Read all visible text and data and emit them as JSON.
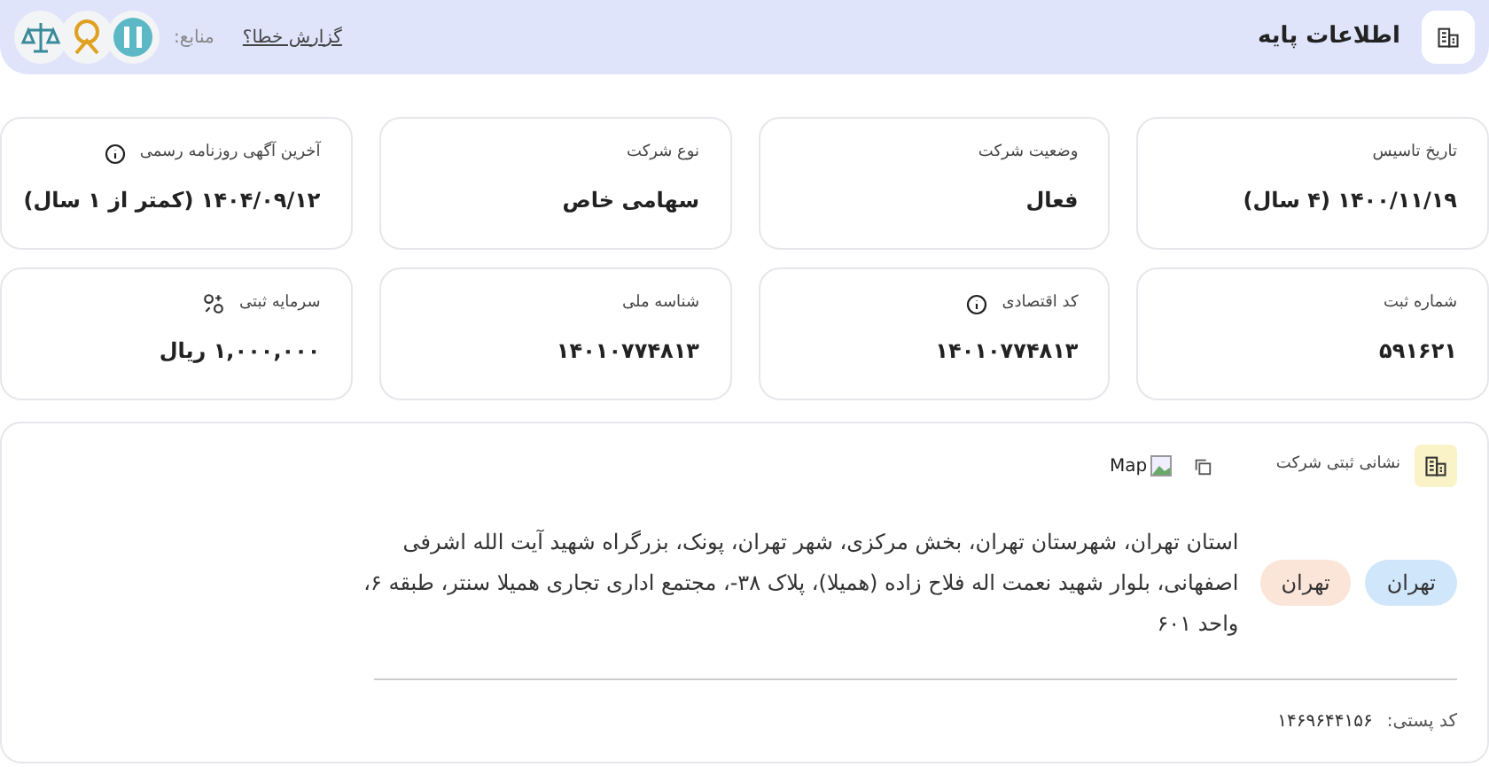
{
  "header": {
    "title": "اطلاعات پایه",
    "report_link": "گزارش خطا؟",
    "sources_label": "منابع:"
  },
  "cards": [
    {
      "label": "تاریخ تاسیس",
      "value": "۱۴۰۰/۱۱/۱۹ (۴ سال)"
    },
    {
      "label": "وضعیت شرکت",
      "value": "فعال"
    },
    {
      "label": "نوع شرکت",
      "value": "سهامی خاص"
    },
    {
      "label": "آخرین آگهی روزنامه رسمی",
      "value": "۱۴۰۴/۰۹/۱۲ (کمتر از ۱ سال)",
      "kind": "info"
    },
    {
      "label": "شماره ثبت",
      "value": "۵۹۱۶۲۱"
    },
    {
      "label": "کد اقتصادی",
      "value": "۱۴۰۱۰۷۷۴۸۱۳",
      "kind": "info"
    },
    {
      "label": "شناسه ملی",
      "value": "۱۴۰۱۰۷۷۴۸۱۳"
    },
    {
      "label": "سرمایه ثبتی",
      "value": "۱,۰۰۰,۰۰۰ ریال",
      "kind": "coins"
    }
  ],
  "address": {
    "title": "نشانی ثبتی شرکت",
    "map_alt": "Map",
    "tags": [
      {
        "label": "تهران",
        "color": "#cfe6fb"
      },
      {
        "label": "تهران",
        "color": "#fbe4d8"
      }
    ],
    "text": "استان تهران، شهرستان تهران، بخش مرکزی، شهر تهران، پونک، بزرگراه شهید آیت الله اشرفی اصفهانی، بلوار شهید نعمت اله فلاح زاده (همیلا)، پلاک ۳۸-، مجتمع اداری تجاری همیلا سنتر، طبقه ۶، واحد ۶۰۱",
    "postal_label": "کد پستی:",
    "postal_code": "۱۴۶۹۶۴۴۱۵۶"
  }
}
